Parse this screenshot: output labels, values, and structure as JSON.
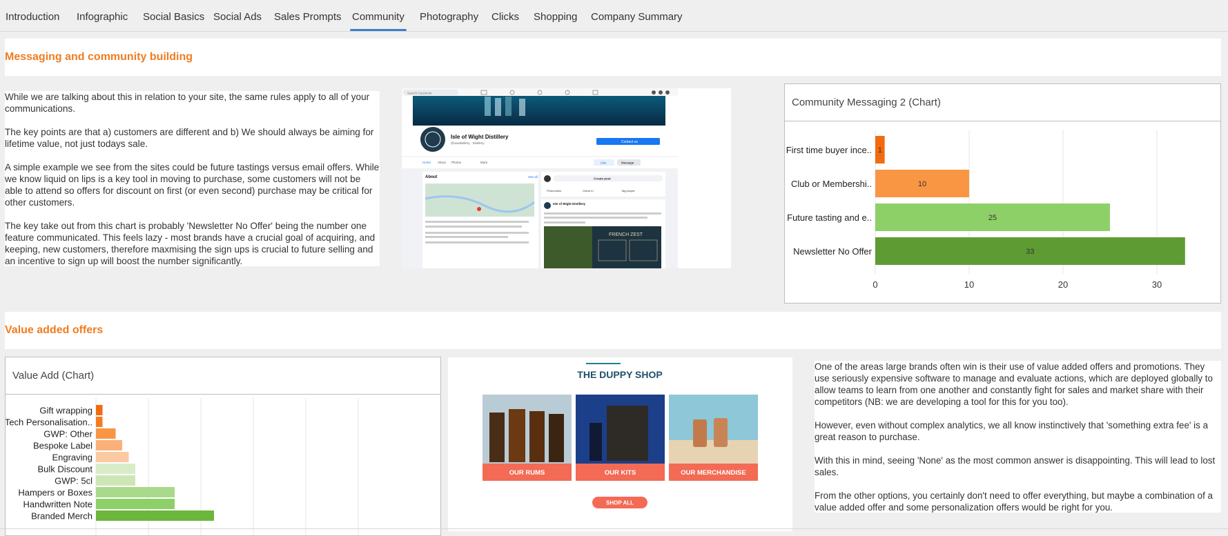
{
  "tabs": [
    {
      "label": "Introduction",
      "active": false
    },
    {
      "label": "Infographic",
      "active": false
    },
    {
      "label": "Social Basics",
      "active": false
    },
    {
      "label": "Social Ads",
      "active": false
    },
    {
      "label": "Sales Prompts",
      "active": false
    },
    {
      "label": "Community",
      "active": true
    },
    {
      "label": "Photography",
      "active": false
    },
    {
      "label": "Clicks",
      "active": false
    },
    {
      "label": "Shopping",
      "active": false
    },
    {
      "label": "Company Summary",
      "active": false
    }
  ],
  "section1": {
    "title": "Messaging and community building",
    "paragraphs": [
      "While we are talking about this in relation to your site, the same rules apply to all of your communications.",
      "The key points are that a) customers are different and b) We should always be aiming for lifetime value, not just todays sale.",
      "A simple example we see from the sites could be future tastings versus email offers. While we know liquid on lips is a key tool in moving to purchase, some customers will not be able to attend so offers for discount on first (or even second) purchase may be critical for other customers.",
      "The key take out from this chart is probably 'Newsletter No Offer' being the number one feature communicated. This feels lazy - most brands have a crucial goal of acquiring, and keeping, new customers, therefore maxmising the sign ups is crucial to future selling and an incentive to sign up will boost the number significantly."
    ],
    "facebook": {
      "search_placeholder": "Search Facebook",
      "page_name": "Isle of Wight Distillery",
      "page_sub": "@iowdistillery · Distillery",
      "contact_button": "Contact us",
      "tabs": [
        "Home",
        "About",
        "Photos",
        "More"
      ],
      "like_button": "Like",
      "message_button": "Message",
      "about_label": "About",
      "see_all": "See all",
      "create_post": "Create post",
      "post_actions": [
        "Photo/video",
        "Check in",
        "Tag people"
      ],
      "post_author": "Isle of Wight Distillery",
      "banner_text": "FRENCH ZEST"
    }
  },
  "chart1": {
    "heading": "Community Messaging 2 (Chart)",
    "chart_data": {
      "type": "bar",
      "orientation": "horizontal",
      "categories": [
        "First time buyer ince..",
        "Club or Membershi..",
        "Future tasting and e..",
        "Newsletter No Offer"
      ],
      "values": [
        1,
        10,
        25,
        33
      ],
      "colors": [
        "#f26b0f",
        "#f99644",
        "#8ed068",
        "#5f9b33"
      ],
      "xticks": [
        0,
        10,
        20,
        30
      ],
      "xlim": [
        0,
        36
      ],
      "grid": true,
      "data_labels": true
    }
  },
  "section2": {
    "title": "Value added offers",
    "paragraphs": [
      "One of the areas large brands often win is their use of value added offers and promotions. They use seriously expensive software to manage and evaluate actions, which are deployed globally to allow teams to learn from one another and constantly fight for sales and market share with their competitors (NB: we are developing a tool for this for you too).",
      "However, even without complex analytics, we all know instinctively that 'something extra fee' is a great reason to purchase.",
      "With this in mind, seeing 'None' as the most common answer is disappointing. This will lead to lost sales.",
      "From the other options, you certainly don't need to offer everything, but maybe a combination of a value added offer and some personalization offers would be right for you."
    ],
    "shop": {
      "title": "THE DUPPY SHOP",
      "tiles": [
        "OUR RUMS",
        "OUR KITS",
        "OUR MERCHANDISE"
      ],
      "shop_all": "SHOP ALL"
    }
  },
  "chart2": {
    "heading": "Value Add (Chart)",
    "chart_data": {
      "type": "bar",
      "orientation": "horizontal",
      "categories": [
        "Gift wrapping",
        "Tech Personalisation..",
        "GWP: Other",
        "Bespoke Label",
        "Engraving",
        "Bulk Discount",
        "GWP: 5cl",
        "Hampers or Boxes",
        "Handwritten Note",
        "Branded Merch"
      ],
      "values": [
        2.5,
        2.5,
        7.5,
        10,
        12.5,
        15,
        15,
        30,
        30,
        45
      ],
      "colors": [
        "#f26b0f",
        "#f47b20",
        "#f99644",
        "#fbb07a",
        "#fccaa2",
        "#d9ecc9",
        "#cde6b6",
        "#a9d98a",
        "#8ed068",
        "#6db63c"
      ],
      "grid": true
    }
  }
}
